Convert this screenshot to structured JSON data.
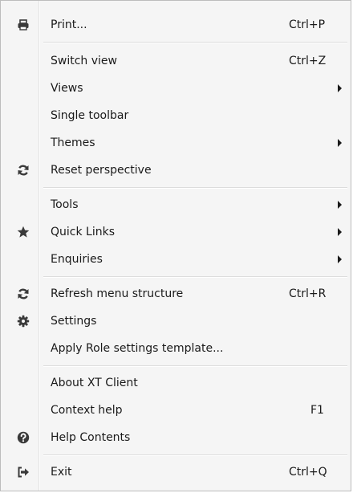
{
  "menu": {
    "print": {
      "label": "Print...",
      "shortcut": "Ctrl+P",
      "icon": "printer-icon"
    },
    "switch_view": {
      "label": "Switch view",
      "shortcut": "Ctrl+Z"
    },
    "views": {
      "label": "Views",
      "submenu": true
    },
    "single_toolbar": {
      "label": "Single toolbar"
    },
    "themes": {
      "label": "Themes",
      "submenu": true
    },
    "reset_perspective": {
      "label": "Reset perspective",
      "icon": "refresh-icon"
    },
    "tools": {
      "label": "Tools",
      "submenu": true
    },
    "quick_links": {
      "label": "Quick Links",
      "submenu": true,
      "icon": "star-icon"
    },
    "enquiries": {
      "label": "Enquiries",
      "submenu": true
    },
    "refresh_menu": {
      "label": "Refresh menu structure",
      "shortcut": "Ctrl+R",
      "icon": "refresh-icon"
    },
    "settings": {
      "label": "Settings",
      "icon": "gear-icon"
    },
    "apply_role": {
      "label": "Apply Role settings template..."
    },
    "about": {
      "label": "About XT Client"
    },
    "context_help": {
      "label": "Context help",
      "shortcut": "F1"
    },
    "help_contents": {
      "label": "Help Contents",
      "icon": "question-circle-icon"
    },
    "exit": {
      "label": "Exit",
      "shortcut": "Ctrl+Q",
      "icon": "sign-out-icon"
    }
  },
  "colors": {
    "background": "#f5f5f5",
    "border": "#bdbdbd",
    "text": "#1a1a1a",
    "icon": "#3a3a3a"
  }
}
